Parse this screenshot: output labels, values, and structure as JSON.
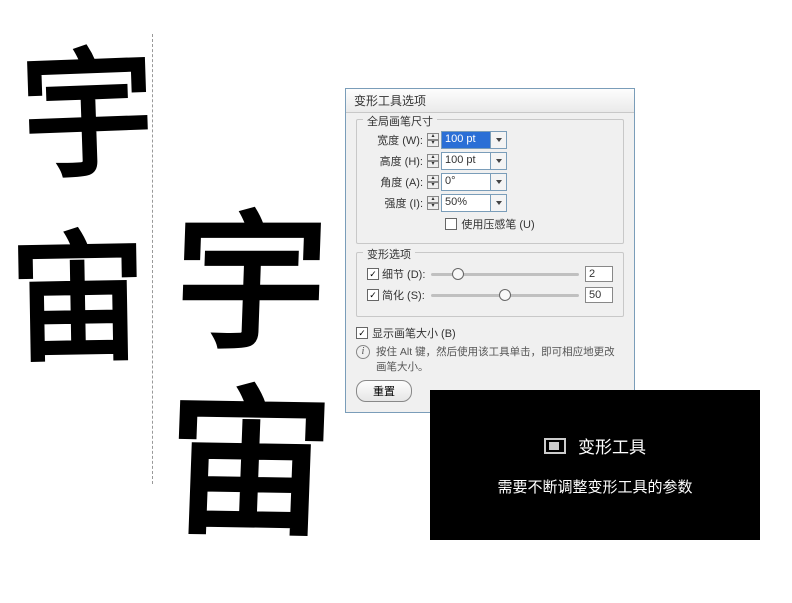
{
  "left_chars": {
    "c1": "宇",
    "c2": "宙"
  },
  "right_chars": {
    "c1": "宇",
    "c2": "宙"
  },
  "dialog": {
    "title": "变形工具选项",
    "brush_section": {
      "legend": "全局画笔尺寸",
      "width_label": "宽度 (W):",
      "width_value": "100 pt",
      "height_label": "高度 (H):",
      "height_value": "100 pt",
      "angle_label": "角度 (A):",
      "angle_value": "0°",
      "intensity_label": "强度 (I):",
      "intensity_value": "50%",
      "pressure_label": "使用压感笔 (U)",
      "pressure_checked": false
    },
    "warp_section": {
      "legend": "变形选项",
      "detail_label": "细节 (D):",
      "detail_value": "2",
      "detail_checked": true,
      "detail_pos_pct": 18,
      "simplify_label": "简化 (S):",
      "simplify_value": "50",
      "simplify_checked": true,
      "simplify_pos_pct": 50
    },
    "show_brush_label": "显示画笔大小 (B)",
    "show_brush_checked": true,
    "info_text": "按住 Alt 键，然后使用该工具单击，即可相应地更改画笔大小。",
    "reset_label": "重置"
  },
  "tip": {
    "title": "变形工具",
    "body": "需要不断调整变形工具的参数"
  }
}
